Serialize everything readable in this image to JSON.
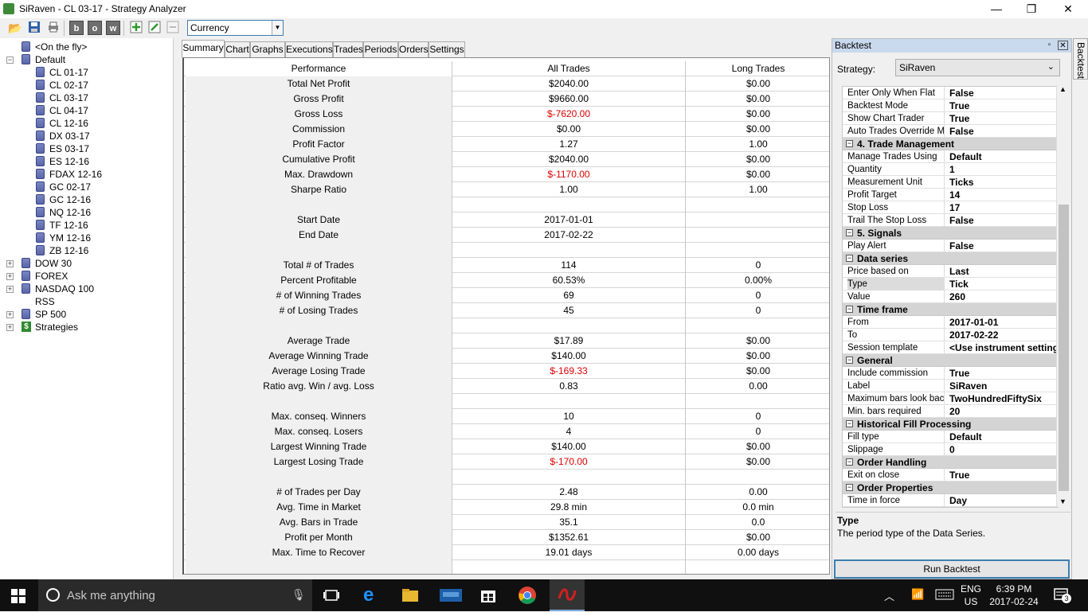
{
  "window": {
    "title": "SiRaven - CL 03-17 - Strategy Analyzer",
    "min": "—",
    "max": "❐",
    "close": "✕"
  },
  "toolbar": {
    "currency_value": "Currency",
    "btn_b": "b",
    "btn_o": "o",
    "btn_w": "w"
  },
  "tree": {
    "items": [
      {
        "label": "<On the fly>",
        "indent": 1,
        "icon": "db",
        "exp": ""
      },
      {
        "label": "Default",
        "indent": 0,
        "icon": "db",
        "exp": "−"
      },
      {
        "label": "CL 01-17",
        "indent": 2,
        "icon": "db",
        "exp": ""
      },
      {
        "label": "CL 02-17",
        "indent": 2,
        "icon": "db",
        "exp": ""
      },
      {
        "label": "CL 03-17",
        "indent": 2,
        "icon": "db",
        "exp": ""
      },
      {
        "label": "CL 04-17",
        "indent": 2,
        "icon": "db",
        "exp": ""
      },
      {
        "label": "CL 12-16",
        "indent": 2,
        "icon": "db",
        "exp": ""
      },
      {
        "label": "DX 03-17",
        "indent": 2,
        "icon": "db",
        "exp": ""
      },
      {
        "label": "ES 03-17",
        "indent": 2,
        "icon": "db",
        "exp": ""
      },
      {
        "label": "ES 12-16",
        "indent": 2,
        "icon": "db",
        "exp": ""
      },
      {
        "label": "FDAX 12-16",
        "indent": 2,
        "icon": "db",
        "exp": ""
      },
      {
        "label": "GC 02-17",
        "indent": 2,
        "icon": "db",
        "exp": ""
      },
      {
        "label": "GC 12-16",
        "indent": 2,
        "icon": "db",
        "exp": ""
      },
      {
        "label": "NQ 12-16",
        "indent": 2,
        "icon": "db",
        "exp": ""
      },
      {
        "label": "TF 12-16",
        "indent": 2,
        "icon": "db",
        "exp": ""
      },
      {
        "label": "YM 12-16",
        "indent": 2,
        "icon": "db",
        "exp": ""
      },
      {
        "label": "ZB 12-16",
        "indent": 2,
        "icon": "db",
        "exp": ""
      },
      {
        "label": "DOW 30",
        "indent": 0,
        "icon": "db",
        "exp": "+"
      },
      {
        "label": "FOREX",
        "indent": 0,
        "icon": "db",
        "exp": "+"
      },
      {
        "label": "NASDAQ 100",
        "indent": 0,
        "icon": "db",
        "exp": "+"
      },
      {
        "label": "RSS",
        "indent": 0,
        "icon": "",
        "exp": ""
      },
      {
        "label": "SP 500",
        "indent": 0,
        "icon": "db",
        "exp": "+"
      },
      {
        "label": "Strategies",
        "indent": 0,
        "icon": "strat",
        "exp": "+"
      }
    ]
  },
  "tabs": [
    "Summary",
    "Chart",
    "Graphs",
    "Executions",
    "Trades",
    "Periods",
    "Orders",
    "Settings"
  ],
  "active_tab": 0,
  "summary": {
    "headers": [
      "Performance",
      "All Trades",
      "Long Trades"
    ],
    "rows": [
      [
        "Total Net Profit",
        "$2040.00",
        "$0.00"
      ],
      [
        "Gross Profit",
        "$9660.00",
        "$0.00"
      ],
      [
        "Gross Loss",
        "$-7620.00",
        "$0.00"
      ],
      [
        "Commission",
        "$0.00",
        "$0.00"
      ],
      [
        "Profit Factor",
        "1.27",
        "1.00"
      ],
      [
        "Cumulative Profit",
        "$2040.00",
        "$0.00"
      ],
      [
        "Max. Drawdown",
        "$-1170.00",
        "$0.00"
      ],
      [
        "Sharpe Ratio",
        "1.00",
        "1.00"
      ],
      [
        "",
        "",
        ""
      ],
      [
        "Start Date",
        "2017-01-01",
        ""
      ],
      [
        "End Date",
        "2017-02-22",
        ""
      ],
      [
        "",
        "",
        ""
      ],
      [
        "Total # of Trades",
        "114",
        "0"
      ],
      [
        "Percent Profitable",
        "60.53%",
        "0.00%"
      ],
      [
        "# of Winning Trades",
        "69",
        "0"
      ],
      [
        "# of Losing Trades",
        "45",
        "0"
      ],
      [
        "",
        "",
        ""
      ],
      [
        "Average Trade",
        "$17.89",
        "$0.00"
      ],
      [
        "Average Winning Trade",
        "$140.00",
        "$0.00"
      ],
      [
        "Average Losing Trade",
        "$-169.33",
        "$0.00"
      ],
      [
        "Ratio avg. Win / avg. Loss",
        "0.83",
        "0.00"
      ],
      [
        "",
        "",
        ""
      ],
      [
        "Max. conseq. Winners",
        "10",
        "0"
      ],
      [
        "Max. conseq. Losers",
        "4",
        "0"
      ],
      [
        "Largest Winning Trade",
        "$140.00",
        "$0.00"
      ],
      [
        "Largest Losing Trade",
        "$-170.00",
        "$0.00"
      ],
      [
        "",
        "",
        ""
      ],
      [
        "# of Trades per Day",
        "2.48",
        "0.00"
      ],
      [
        "Avg. Time in Market",
        "29.8 min",
        "0.0 min"
      ],
      [
        "Avg. Bars in Trade",
        "35.1",
        "0.0"
      ],
      [
        "Profit per Month",
        "$1352.61",
        "$0.00"
      ],
      [
        "Max. Time to Recover",
        "19.01 days",
        "0.00 days"
      ],
      [
        "",
        "",
        ""
      ]
    ]
  },
  "backtest": {
    "title": "Backtest",
    "strategy_label": "Strategy:",
    "strategy_value": "SiRaven",
    "props": [
      {
        "k": "Enter Only When Flat",
        "v": "False"
      },
      {
        "k": "Backtest Mode",
        "v": "True"
      },
      {
        "k": "Show Chart Trader",
        "v": "True"
      },
      {
        "k": "Auto Trades Override Ma",
        "v": "False"
      },
      {
        "cat": "4. Trade Management"
      },
      {
        "k": "Manage Trades Using",
        "v": "Default"
      },
      {
        "k": "Quantity",
        "v": "1"
      },
      {
        "k": "Measurement Unit",
        "v": "Ticks"
      },
      {
        "k": "Profit Target",
        "v": "14"
      },
      {
        "k": "Stop Loss",
        "v": "17"
      },
      {
        "k": "Trail The Stop Loss",
        "v": "False"
      },
      {
        "cat": "5. Signals"
      },
      {
        "k": "Play Alert",
        "v": "False"
      },
      {
        "cat": "Data series"
      },
      {
        "k": "Price based on",
        "v": "Last"
      },
      {
        "k": "Type",
        "v": "Tick",
        "sel": true
      },
      {
        "k": "Value",
        "v": "260"
      },
      {
        "cat": "Time frame"
      },
      {
        "k": "From",
        "v": "2017-01-01"
      },
      {
        "k": "To",
        "v": "2017-02-22"
      },
      {
        "k": "Session template",
        "v": "<Use instrument settings"
      },
      {
        "cat": "General"
      },
      {
        "k": "Include commission",
        "v": "True"
      },
      {
        "k": "Label",
        "v": "SiRaven"
      },
      {
        "k": "Maximum bars look back",
        "v": "TwoHundredFiftySix"
      },
      {
        "k": "Min. bars required",
        "v": "20"
      },
      {
        "cat": "Historical Fill Processing"
      },
      {
        "k": "Fill type",
        "v": "Default"
      },
      {
        "k": "Slippage",
        "v": "0"
      },
      {
        "cat": "Order Handling"
      },
      {
        "k": "Exit on close",
        "v": "True"
      },
      {
        "cat": "Order Properties"
      },
      {
        "k": "Time in force",
        "v": "Day"
      }
    ],
    "desc_title": "Type",
    "desc_text": "The period type of the Data Series.",
    "run_label": "Run Backtest",
    "side_tab": "Backtest"
  },
  "taskbar": {
    "search_placeholder": "Ask me anything",
    "lang1": "ENG",
    "lang2": "US",
    "time": "6:39 PM",
    "date": "2017-02-24",
    "notif_count": "3"
  },
  "colors": {
    "negative": "#e00000",
    "accent": "#3c7fb1"
  }
}
